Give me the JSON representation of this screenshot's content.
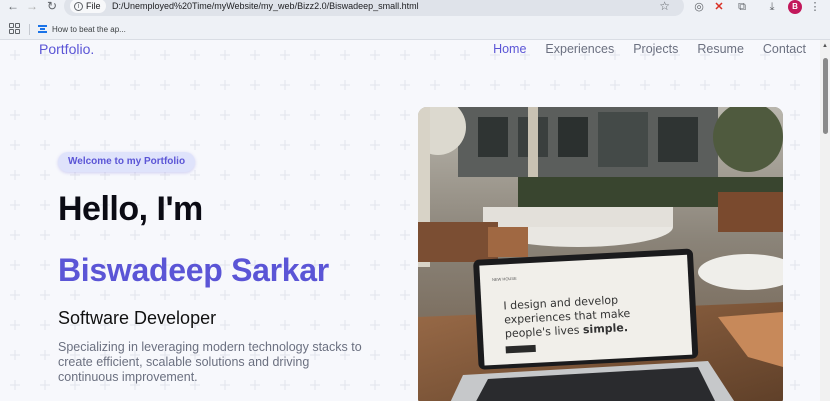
{
  "browser": {
    "file_chip": "File",
    "url": "D:/Unemployed%20Time/myWebsite/my_web/Bizz2.0/Biswadeep_small.html",
    "bookmark": "How to beat the ap...",
    "profile_initial": "B"
  },
  "site": {
    "logo": "Portfolio.",
    "nav": [
      "Home",
      "Experiences",
      "Projects",
      "Resume",
      "Contact"
    ],
    "accent": "#5b55d6"
  },
  "hero": {
    "badge": "Welcome to my Portfolio",
    "greeting": "Hello, I'm",
    "name": "Biswadeep Sarkar",
    "role": "Software Developer",
    "tagline": "Specializing in leveraging modern technology stacks to create efficient, scalable solutions and driving continuous improvement.",
    "image": {
      "screen_line1": "I design and develop",
      "screen_line2": "experiences that make",
      "screen_line3_a": "people's lives ",
      "screen_line3_b": "simple."
    }
  }
}
